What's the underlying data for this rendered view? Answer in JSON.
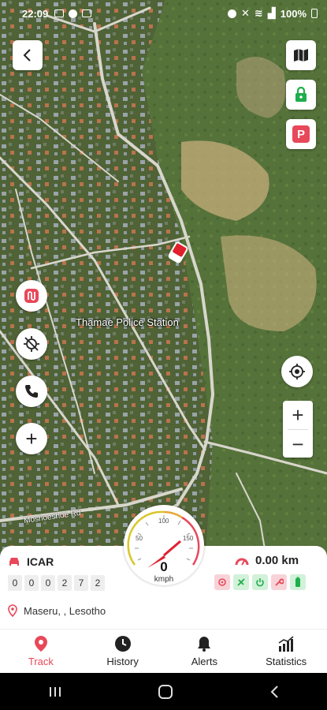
{
  "status_bar": {
    "time": "22:09",
    "battery": "100%"
  },
  "map": {
    "place_label": "Thamae Police Station",
    "road_label": "Moshoeshoe Rd"
  },
  "buttons": {
    "back": "back-icon",
    "map_type": "map-type-icon",
    "lock": "lock-icon",
    "parking": "P",
    "route": "route-icon",
    "gps_off": "gps-off-icon",
    "call": "phone-icon",
    "add": "+",
    "locate": "locate-icon",
    "zoom_in": "+",
    "zoom_out": "−"
  },
  "vehicle": {
    "name": "ICAR",
    "odometer": [
      "0",
      "0",
      "0",
      "2",
      "7",
      "2"
    ],
    "location": "Maseru, , Lesotho",
    "distance": "0.00 km"
  },
  "speedometer": {
    "speed": "0",
    "unit": "kmph",
    "ticks": [
      "50",
      "100",
      "150"
    ]
  },
  "status_icons": [
    "ignition-icon",
    "gps-signal-icon",
    "power-icon",
    "service-icon",
    "battery-icon"
  ],
  "colors": {
    "accent": "#e8485a",
    "green": "#1fae4b",
    "pink": "#f7d3d8",
    "green_bg": "#d2f1d9"
  },
  "nav": {
    "items": [
      {
        "label": "Track",
        "icon": "location-pin-icon",
        "active": true
      },
      {
        "label": "History",
        "icon": "clock-icon",
        "active": false
      },
      {
        "label": "Alerts",
        "icon": "bell-icon",
        "active": false
      },
      {
        "label": "Statistics",
        "icon": "bar-chart-icon",
        "active": false
      }
    ]
  }
}
